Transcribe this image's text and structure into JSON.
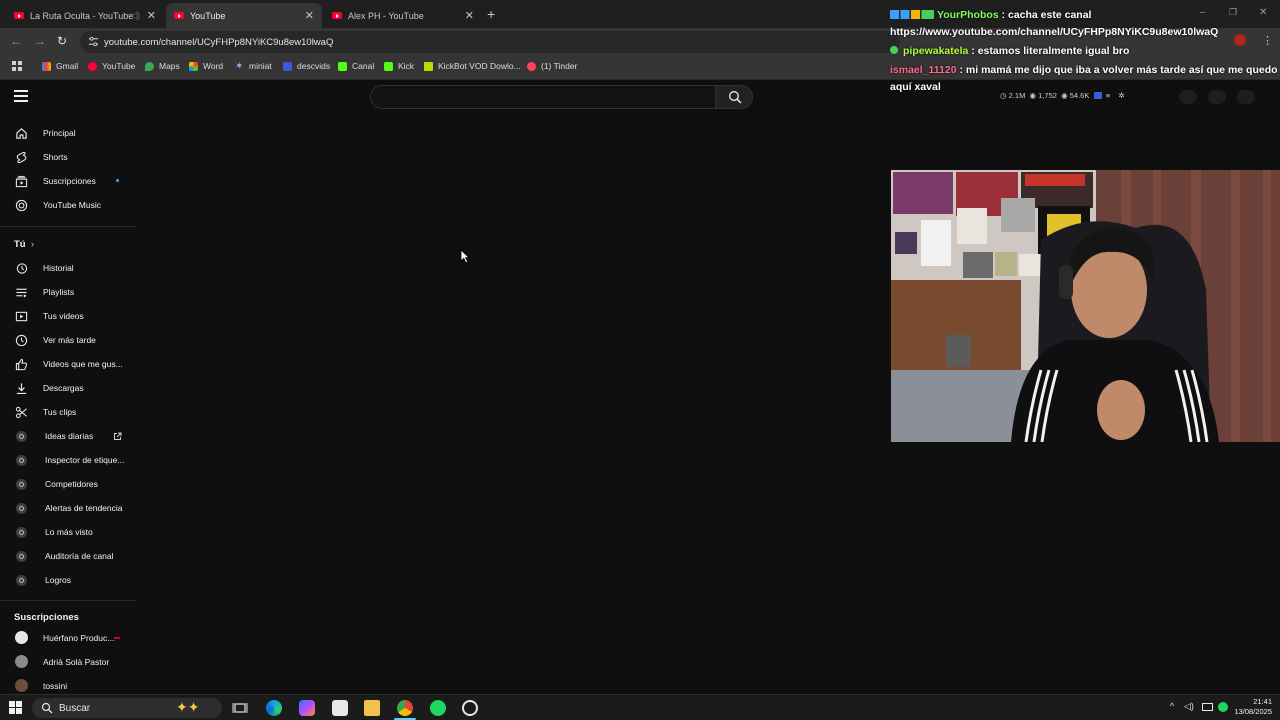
{
  "tabs": [
    {
      "title": "La Ruta Oculta - YouTube"
    },
    {
      "title": "YouTube"
    },
    {
      "title": "Alex PH - YouTube"
    }
  ],
  "address_bar": {
    "url": "youtube.com/channel/UCyFHPp8NYiKC9u8ew10lwaQ"
  },
  "bookmarks": [
    {
      "label": "Gmail"
    },
    {
      "label": "YouTube"
    },
    {
      "label": "Maps"
    },
    {
      "label": "Word"
    },
    {
      "label": "miniat"
    },
    {
      "label": "descvids"
    },
    {
      "label": "Canal"
    },
    {
      "label": "Kick"
    },
    {
      "label": "KickBot VOD Dowlo..."
    },
    {
      "label": "(1) Tinder"
    }
  ],
  "sidebar": {
    "main": [
      {
        "label": "Principal"
      },
      {
        "label": "Shorts"
      },
      {
        "label": "Suscripciones"
      },
      {
        "label": "YouTube Music"
      }
    ],
    "you_heading": "Tú",
    "you": [
      {
        "label": "Historial"
      },
      {
        "label": "Playlists"
      },
      {
        "label": "Tus videos"
      },
      {
        "label": "Ver más tarde"
      },
      {
        "label": "Videos que me gus..."
      },
      {
        "label": "Descargas"
      },
      {
        "label": "Tus clips"
      }
    ],
    "tools": [
      {
        "label": "Ideas diarias"
      },
      {
        "label": "Inspector de etique..."
      },
      {
        "label": "Competidores"
      },
      {
        "label": "Alertas de tendencia"
      },
      {
        "label": "Lo más visto"
      },
      {
        "label": "Auditoría de canal"
      },
      {
        "label": "Logros"
      }
    ],
    "subs_heading": "Suscripciones",
    "subs": [
      {
        "label": "Huérfano Produc..."
      },
      {
        "label": "Adrià Solà Pastor"
      },
      {
        "label": "tossini"
      }
    ]
  },
  "chat": [
    {
      "user": "YourPhobos",
      "sep": " : ",
      "message": "cacha este canal"
    },
    {
      "user": "",
      "sep": "",
      "message": "https://www.youtube.com/channel/UCyFHPp8NYiKC9u8ew10lwaQ"
    },
    {
      "user": "pipewakatela",
      "sep": " : ",
      "message": "estamos literalmente igual bro"
    },
    {
      "user": "ismael_11120",
      "sep": " : ",
      "message": "mi mamá me dijo que iba a volver más tarde así que me quedo"
    },
    {
      "user": "",
      "sep": "",
      "message": "aquí xaval"
    }
  ],
  "stream_stats": {
    "viewers_total": "2.1M",
    "viewers_live": "1,752",
    "followers": "54.6K"
  },
  "taskbar": {
    "search_placeholder": "Buscar",
    "time": "21:41",
    "date": "13/08/2025"
  },
  "colors": {
    "yt_bg": "#0f0f0f",
    "brand_red": "#ff0033",
    "chat_user_1": "#7dff5c",
    "chat_user_2": "#b6ff3b",
    "chat_user_3": "#ff6a8c"
  }
}
